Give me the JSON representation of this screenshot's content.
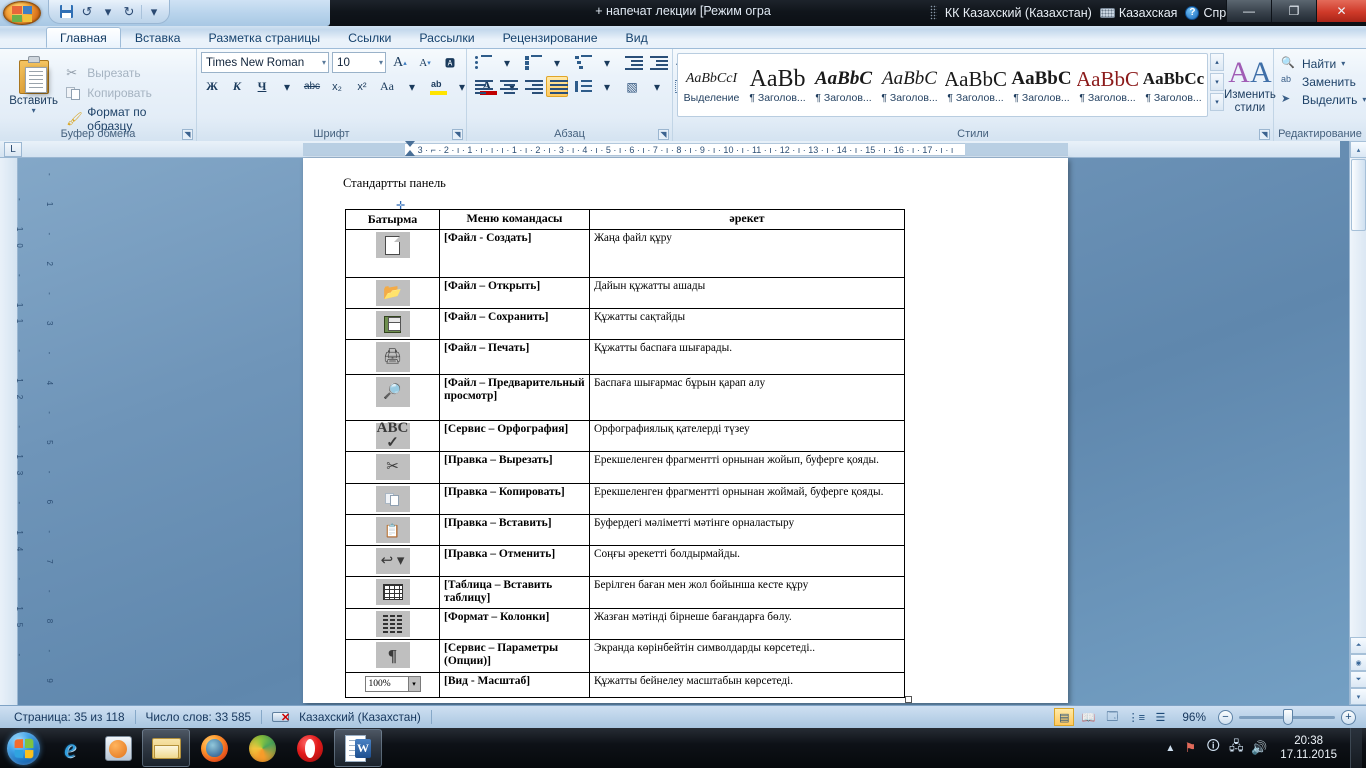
{
  "titlebar": {
    "document_title": "+ напечат лекции [Режим огра",
    "quick_access": [
      "save-icon",
      "undo-icon",
      "redo-icon",
      "customize-icon"
    ],
    "language_bar": {
      "layout": "КК Казахский (Казахстан)",
      "keyboard": "Казахская",
      "help": "Справка"
    },
    "window_controls": {
      "minimize": "—",
      "maximize": "❐",
      "close": "✕"
    }
  },
  "ribbon": {
    "tabs": [
      {
        "label": "Главная",
        "active": true
      },
      {
        "label": "Вставка",
        "active": false
      },
      {
        "label": "Разметка страницы",
        "active": false
      },
      {
        "label": "Ссылки",
        "active": false
      },
      {
        "label": "Рассылки",
        "active": false
      },
      {
        "label": "Рецензирование",
        "active": false
      },
      {
        "label": "Вид",
        "active": false
      }
    ],
    "clipboard": {
      "group_title": "Буфер обмена",
      "paste": "Вставить",
      "cut": "Вырезать",
      "copy": "Копировать",
      "format_painter": "Формат по образцу"
    },
    "font": {
      "group_title": "Шрифт",
      "font_name": "Times New Roman",
      "font_size": "10",
      "grow_font": "A",
      "shrink_font": "A",
      "clear_formatting": "Aa",
      "bold": "Ж",
      "italic": "К",
      "underline": "Ч",
      "strikethrough": "abc",
      "subscript": "x₂",
      "superscript": "x²",
      "change_case": "Aa",
      "highlight": "ab",
      "font_color": "A"
    },
    "paragraph": {
      "group_title": "Абзац",
      "buttons": [
        "bullets",
        "numbering",
        "multilevel-list",
        "decrease-indent",
        "increase-indent",
        "sort",
        "show-marks",
        "align-left",
        "align-center",
        "align-right",
        "justify",
        "line-spacing",
        "shading",
        "borders"
      ],
      "active_alignment": "justify"
    },
    "styles": {
      "group_title": "Стили",
      "items": [
        {
          "preview": "AaBbCcI",
          "name": "Выделение"
        },
        {
          "preview": "AaBb",
          "name": "¶ Заголов..."
        },
        {
          "preview": "AaBbC",
          "name": "¶ Заголов..."
        },
        {
          "preview": "AaBbC",
          "name": "¶ Заголов..."
        },
        {
          "preview": "AaBbC",
          "name": "¶ Заголов..."
        },
        {
          "preview": "AaBbC",
          "name": "¶ Заголов..."
        },
        {
          "preview": "AaBbC",
          "name": "¶ Заголов..."
        },
        {
          "preview": "AaBbCc",
          "name": "¶ Заголов..."
        }
      ],
      "change_styles": "Изменить стили"
    },
    "editing": {
      "group_title": "Редактирование",
      "find": "Найти",
      "replace": "Заменить",
      "select": "Выделить"
    }
  },
  "ruler": {
    "tab_selector": "L",
    "marks": "3 · ⌐ · 2 · ı · 1 · ı · ı · ı · 1 · ı · 2 · ı · 3 · ı · 4 · ı · 5 · ı · 6 · ı · 7 · ı · 8 · ı · 9 · ı · 10 · ı · 11 · ı · 12 · ı · 13 · ı · 14 · ı · 15 · ı · 16 · ı · 17 · ı · ı",
    "vertical_marks": "- 1 - 2 - 3 - 4 - 5 - 6 - 7 - 8 - 9 - 10 - 11 - 12 - 13 - 14 - 15 -"
  },
  "document": {
    "heading": "Стандартты панель",
    "table": {
      "headers": [
        "Батырма",
        "Меню командасы",
        "әрекет"
      ],
      "rows": [
        {
          "icon": "new-document-icon",
          "command": "[Файл - Создать]",
          "action": "Жаңа файл құру"
        },
        {
          "icon": "open-folder-icon",
          "command": "[Файл – Открыть]",
          "action": "Дайын құжатты ашады"
        },
        {
          "icon": "save-disk-icon",
          "command": "[Файл – Сохранить]",
          "action": "Құжатты сақтайды"
        },
        {
          "icon": "printer-icon",
          "command": "[Файл – Печать]",
          "action": "Құжатты баспаға шығарады."
        },
        {
          "icon": "print-preview-icon",
          "command": "[Файл – Предварительный просмотр]",
          "action": "Баспаға шығармас бұрын қарап алу"
        },
        {
          "icon": "spellcheck-icon",
          "command": "[Сервис – Орфография]",
          "action": "Орфографиялық қателерді түзеу"
        },
        {
          "icon": "scissors-icon",
          "command": "[Правка – Вырезать]",
          "action": "Ерекшеленген фрагментті орнынан жойып, буферге қояды."
        },
        {
          "icon": "copy-icon",
          "command": "[Правка – Копировать]",
          "action": "Ерекшеленген фрагментті орнынан жоймай, буферге қояды."
        },
        {
          "icon": "paste-icon",
          "command": "[Правка – Вставить]",
          "action": "Буфердегі мәліметті мәтінге орналастыру"
        },
        {
          "icon": "undo-icon",
          "command": "[Правка – Отменить]",
          "action": "Соңғы әрекетті болдырмайды."
        },
        {
          "icon": "insert-table-icon",
          "command": "[Таблица – Вставить таблицу]",
          "action": "Берілген баған мен жол бойынша кесте құру"
        },
        {
          "icon": "columns-icon",
          "command": "[Формат – Колонки]",
          "action": "Жазған мәтінді бірнеше бағандарға бөлу."
        },
        {
          "icon": "show-marks-icon",
          "command": "[Сервис – Параметры (Опции)]",
          "action": "Экранда көрінбейтін символдарды көрсетеді.."
        },
        {
          "icon": "zoom-combo-icon",
          "command": "[Вид - Масштаб]",
          "action": "Құжатты бейнелеу масштабын көрсетеді."
        }
      ],
      "zoom_combo_value": "100%"
    }
  },
  "statusbar": {
    "page": "Страница: 35 из 118",
    "words": "Число слов: 33 585",
    "language": "Казахский (Казахстан)",
    "zoom_level": "96%",
    "view_buttons": [
      "print-layout",
      "full-screen-reading",
      "web-layout",
      "outline",
      "draft"
    ],
    "active_view": "print-layout",
    "zoom_out": "−",
    "zoom_in": "+"
  },
  "taskbar": {
    "start": "start-orb",
    "items": [
      {
        "icon": "internet-explorer-icon",
        "open": false
      },
      {
        "icon": "windows-media-player-icon",
        "open": false
      },
      {
        "icon": "file-explorer-icon",
        "open": true
      },
      {
        "icon": "firefox-icon",
        "open": false
      },
      {
        "icon": "browser-ball-icon",
        "open": false
      },
      {
        "icon": "opera-icon",
        "open": false
      },
      {
        "icon": "microsoft-word-icon",
        "open": true
      }
    ],
    "tray": [
      "hidden-icons-arrow",
      "flag-icon",
      "info-icon",
      "network-icon",
      "volume-icon"
    ],
    "clock_time": "20:38",
    "clock_date": "17.11.2015"
  }
}
